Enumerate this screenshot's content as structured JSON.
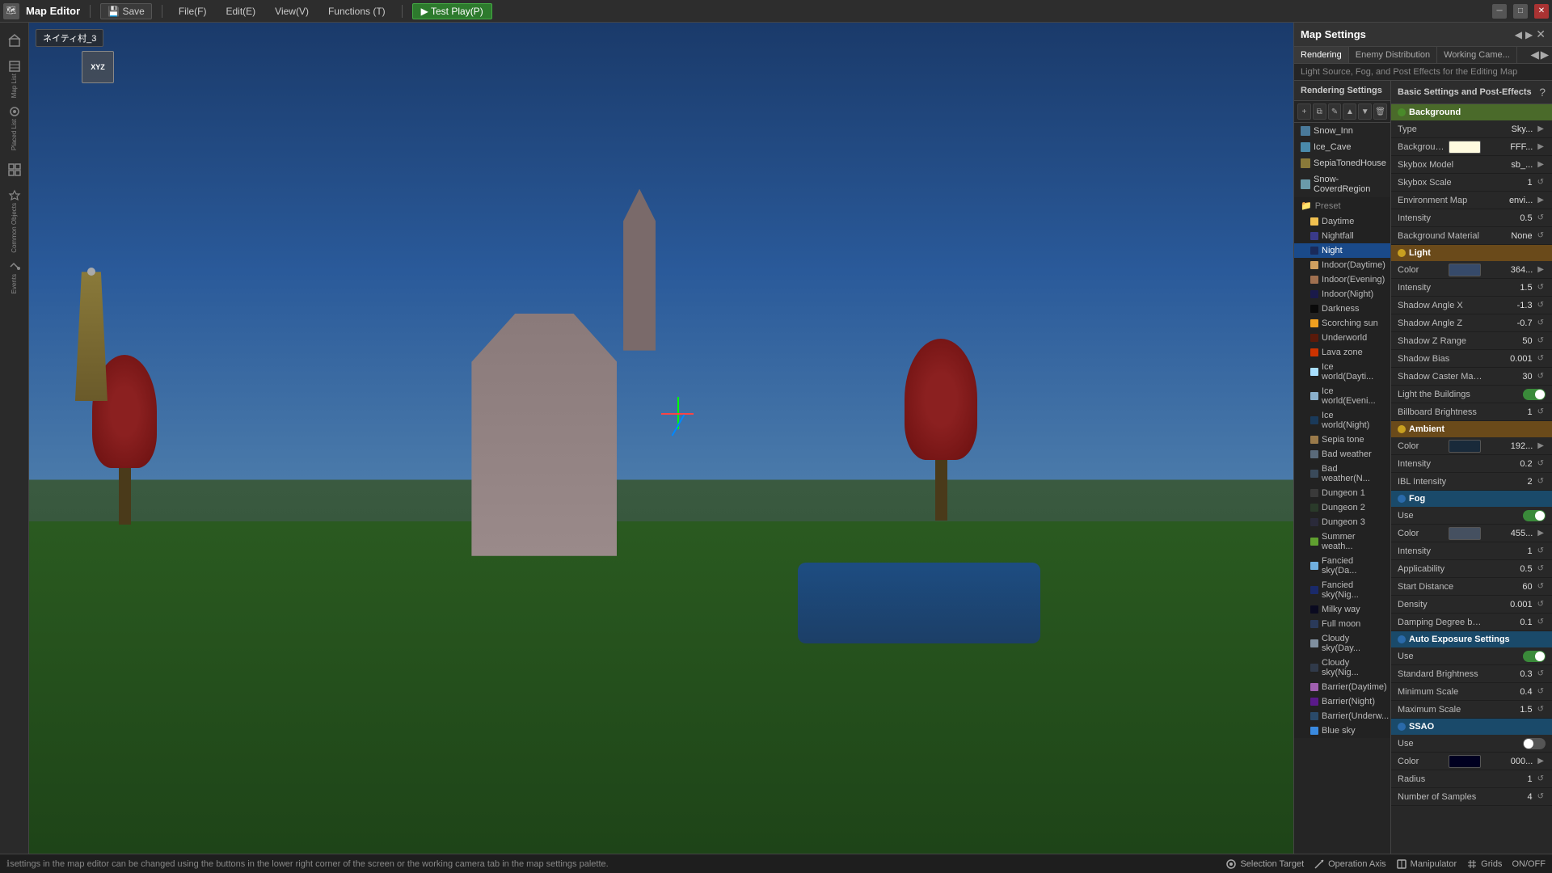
{
  "topbar": {
    "app_icon": "🗺",
    "title": "Map Editor",
    "save_label": "💾 Save",
    "file_label": "File(F)",
    "edit_label": "Edit(E)",
    "view_label": "View(V)",
    "functions_label": "Functions (T)",
    "test_play_label": "▶ Test Play(P)",
    "minimize": "─",
    "maximize": "□",
    "close": "✕"
  },
  "viewport": {
    "name_label": "ネイティ村_3",
    "axes": {
      "x": "X",
      "y": "Y",
      "z": "Z"
    }
  },
  "rendering_settings": {
    "header": "Rendering Settings",
    "items": [
      {
        "id": "snow-inn",
        "label": "Snow_Inn",
        "active": false
      },
      {
        "id": "ice-cave",
        "label": "Ice_Cave",
        "active": false
      },
      {
        "id": "sepia-toned-house",
        "label": "SepiaTonedHouse",
        "active": false
      },
      {
        "id": "snow-covered",
        "label": "Snow-CoverdRegion",
        "active": false
      }
    ],
    "preset": {
      "header": "Preset",
      "items": [
        {
          "id": "daytime",
          "label": "Daytime"
        },
        {
          "id": "nightfall",
          "label": "Nightfall"
        },
        {
          "id": "night",
          "label": "Night",
          "selected": true
        },
        {
          "id": "indoor-daytime",
          "label": "Indoor(Daytime)"
        },
        {
          "id": "indoor-evening",
          "label": "Indoor(Evening)"
        },
        {
          "id": "indoor-night",
          "label": "Indoor(Night)"
        },
        {
          "id": "darkness",
          "label": "Darkness"
        },
        {
          "id": "scorching-sun",
          "label": "Scorching sun"
        },
        {
          "id": "underworld",
          "label": "Underworld"
        },
        {
          "id": "lava-zone",
          "label": "Lava zone"
        },
        {
          "id": "ice-world-day",
          "label": "Ice world(Dayti..."
        },
        {
          "id": "ice-world-even",
          "label": "Ice world(Eveni..."
        },
        {
          "id": "ice-world-night",
          "label": "Ice world(Night)"
        },
        {
          "id": "sepia-tone",
          "label": "Sepia tone"
        },
        {
          "id": "bad-weather",
          "label": "Bad weather"
        },
        {
          "id": "bad-weather-n",
          "label": "Bad weather(N..."
        },
        {
          "id": "dungeon-1",
          "label": "Dungeon 1"
        },
        {
          "id": "dungeon-2",
          "label": "Dungeon 2"
        },
        {
          "id": "dungeon-3",
          "label": "Dungeon 3"
        },
        {
          "id": "summer-weath",
          "label": "Summer weath..."
        },
        {
          "id": "fancied-sky-day",
          "label": "Fancied sky(Da..."
        },
        {
          "id": "fancied-sky-nig",
          "label": "Fancied sky(Nig..."
        },
        {
          "id": "milky-way",
          "label": "Milky way"
        },
        {
          "id": "full-moon",
          "label": "Full moon"
        },
        {
          "id": "cloudy-sky-day",
          "label": "Cloudy sky(Day..."
        },
        {
          "id": "cloudy-sky-nig",
          "label": "Cloudy sky(Nig..."
        },
        {
          "id": "barrier-daytime",
          "label": "Barrier(Daytime)"
        },
        {
          "id": "barrier-night",
          "label": "Barrier(Night)"
        },
        {
          "id": "barrier-underw",
          "label": "Barrier(Underw..."
        },
        {
          "id": "blue-sky",
          "label": "Blue sky"
        }
      ]
    }
  },
  "basic_settings": {
    "header": "Basic Settings and Post-Effects",
    "background": {
      "section": "Background",
      "type": {
        "label": "Type",
        "value": "Sky..."
      },
      "background_color": {
        "label": "Background Color",
        "value": "FFF...",
        "color": "#fffbe0"
      },
      "skybox_model": {
        "label": "Skybox Model",
        "value": "sb_..."
      },
      "skybox_scale": {
        "label": "Skybox Scale",
        "value": "1"
      },
      "environment_map": {
        "label": "Environment Map",
        "value": "envi..."
      },
      "intensity": {
        "label": "Intensity",
        "value": "0.5"
      },
      "background_material": {
        "label": "Background Material",
        "value": "None"
      }
    },
    "light": {
      "section": "Light",
      "color": {
        "label": "Color",
        "value": "364...",
        "color": "#364a6a"
      },
      "intensity": {
        "label": "Intensity",
        "value": "1.5"
      },
      "shadow_angle_x": {
        "label": "Shadow Angle X",
        "value": "-1.3"
      },
      "shadow_angle_z": {
        "label": "Shadow Angle Z",
        "value": "-0.7"
      },
      "shadow_z_range": {
        "label": "Shadow Z Range",
        "value": "50"
      },
      "shadow_bias": {
        "label": "Shadow Bias",
        "value": "0.001"
      },
      "shadow_caster_margin": {
        "label": "Shadow Caster Margin",
        "value": "30"
      },
      "light_buildings": {
        "label": "Light the Buildings",
        "toggle": true
      },
      "billboard_brightness": {
        "label": "Billboard Brightness",
        "value": "1"
      }
    },
    "ambient": {
      "section": "Ambient",
      "color": {
        "label": "Color",
        "value": "192...",
        "color": "#192a3a"
      },
      "intensity": {
        "label": "Intensity",
        "value": "0.2"
      },
      "ibl_intensity": {
        "label": "IBL Intensity",
        "value": "2"
      }
    },
    "fog": {
      "section": "Fog",
      "use": {
        "label": "Use",
        "toggle": true
      },
      "color": {
        "label": "Color",
        "value": "455...",
        "color": "#455060"
      },
      "intensity": {
        "label": "Intensity",
        "value": "1"
      },
      "applicability": {
        "label": "Applicability",
        "value": "0.5"
      },
      "start_distance": {
        "label": "Start Distance",
        "value": "60"
      },
      "density": {
        "label": "Density",
        "value": "0.001"
      },
      "damping_degree": {
        "label": "Damping Degree by ...",
        "value": "0.1"
      }
    },
    "auto_exposure": {
      "section": "Auto Exposure Settings",
      "use": {
        "label": "Use",
        "toggle": true
      },
      "standard_brightness": {
        "label": "Standard Brightness",
        "value": "0.3"
      },
      "minimum_scale": {
        "label": "Minimum Scale",
        "value": "0.4"
      },
      "maximum_scale": {
        "label": "Maximum Scale",
        "value": "1.5"
      }
    },
    "ssao": {
      "section": "SSAO",
      "use": {
        "label": "Use",
        "toggle": false
      },
      "color": {
        "label": "Color",
        "value": "000...",
        "color": "#000020"
      },
      "radius": {
        "label": "Radius",
        "value": "1"
      },
      "number_of_samples": {
        "label": "Number of Samples",
        "value": "4"
      }
    }
  },
  "statusbar": {
    "text": "settings in the map editor can be changed using the buttons in the lower right corner of the screen or the working camera tab in the map settings palette."
  },
  "bottom_toolbar": {
    "selection_target": "Selection Target",
    "operation_axis": "Operation Axis",
    "manipulator": "Manipulator",
    "grids": "Grids",
    "on_off": "ON/OFF"
  }
}
